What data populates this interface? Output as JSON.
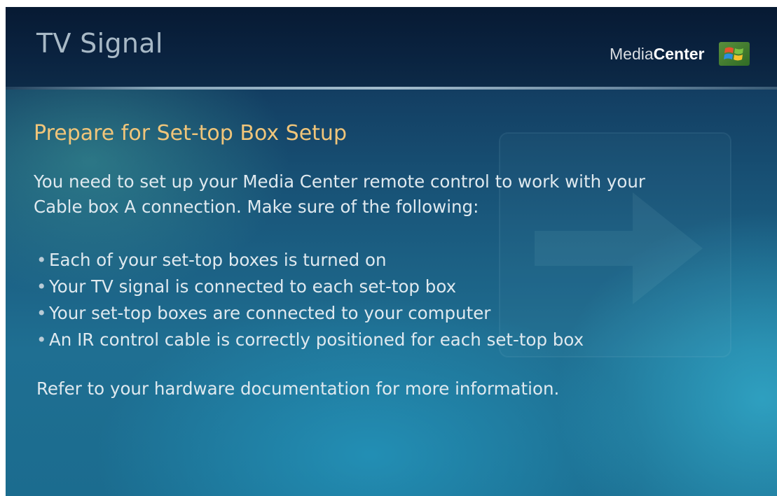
{
  "header": {
    "title": "TV Signal",
    "brand_prefix": "Media",
    "brand_bold": "Center",
    "logo_icon": "windows-flag-icon"
  },
  "page": {
    "heading": "Prepare for Set-top Box Setup",
    "intro_line1": "You need to set up your Media Center remote control to work with your",
    "intro_line2": "Cable box A connection. Make sure of the following:",
    "checklist": [
      "Each of your set-top boxes is turned on",
      "Your TV signal is connected to each set-top box",
      "Your set-top boxes are connected to your computer",
      "An IR control cable is correctly positioned for each set-top box"
    ],
    "bullet_char": "•",
    "footer_note": "Refer to your hardware documentation for more information."
  },
  "colors": {
    "heading": "#f0c57a",
    "body_text": "#dfe9ef",
    "title_text": "#a8b9c6"
  }
}
